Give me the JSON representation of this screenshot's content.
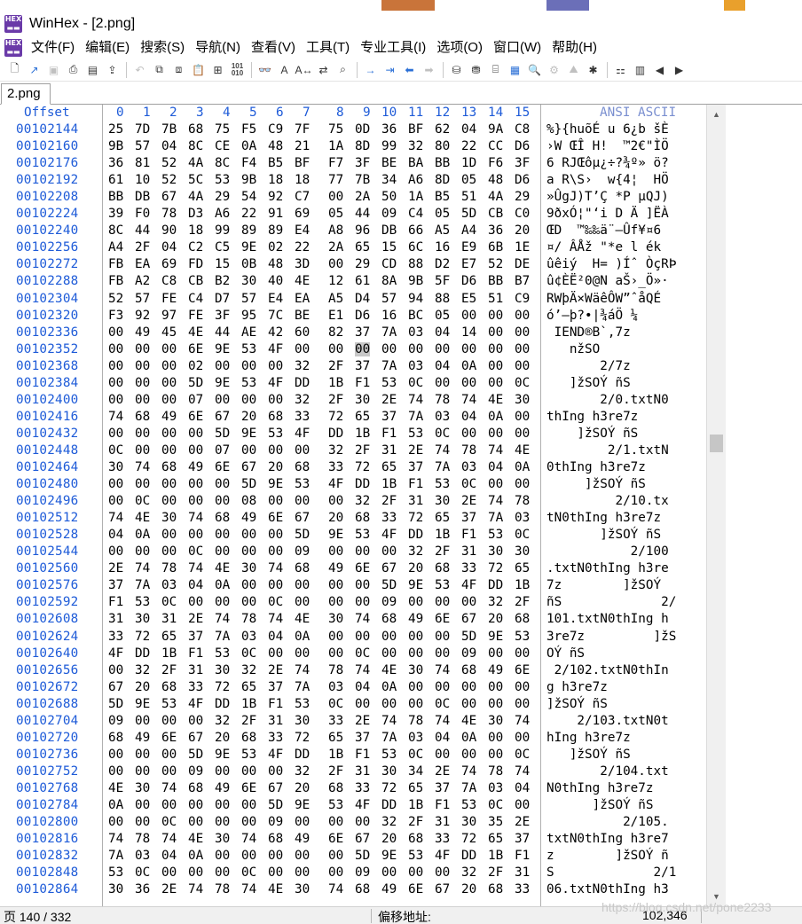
{
  "window": {
    "title": "WinHex - [2.png]",
    "app_icon_text": "HEX"
  },
  "menu": [
    "文件(F)",
    "编辑(E)",
    "搜索(S)",
    "导航(N)",
    "查看(V)",
    "工具(T)",
    "专业工具(I)",
    "选项(O)",
    "窗口(W)",
    "帮助(H)"
  ],
  "tabs": [
    {
      "label": "2.png",
      "active": true
    }
  ],
  "header": {
    "offset_label": "Offset",
    "columns": [
      "0",
      "1",
      "2",
      "3",
      "4",
      "5",
      "6",
      "7",
      "8",
      "9",
      "10",
      "11",
      "12",
      "13",
      "14",
      "15"
    ],
    "ansi_label": "ANSI ASCII"
  },
  "cursor": {
    "row": 13,
    "col": 9
  },
  "rows": [
    {
      "offset": "00102144",
      "bytes": [
        "25",
        "7D",
        "7B",
        "68",
        "75",
        "F5",
        "C9",
        "7F",
        "75",
        "0D",
        "36",
        "BF",
        "62",
        "04",
        "9A",
        "C8"
      ],
      "ascii": "%}{huõÉ u 6¿b šÈ"
    },
    {
      "offset": "00102160",
      "bytes": [
        "9B",
        "57",
        "04",
        "8C",
        "CE",
        "0A",
        "48",
        "21",
        "1A",
        "8D",
        "99",
        "32",
        "80",
        "22",
        "CC",
        "D6"
      ],
      "ascii": "›W ŒÎ H!  ™2€\"ÌÖ"
    },
    {
      "offset": "00102176",
      "bytes": [
        "36",
        "81",
        "52",
        "4A",
        "8C",
        "F4",
        "B5",
        "BF",
        "F7",
        "3F",
        "BE",
        "BA",
        "BB",
        "1D",
        "F6",
        "3F"
      ],
      "ascii": "6 RJŒôµ¿÷?¾º» ö?"
    },
    {
      "offset": "00102192",
      "bytes": [
        "61",
        "10",
        "52",
        "5C",
        "53",
        "9B",
        "18",
        "18",
        "77",
        "7B",
        "34",
        "A6",
        "8D",
        "05",
        "48",
        "D6"
      ],
      "ascii": "a R\\S›  w{4¦  HÖ"
    },
    {
      "offset": "00102208",
      "bytes": [
        "BB",
        "DB",
        "67",
        "4A",
        "29",
        "54",
        "92",
        "C7",
        "00",
        "2A",
        "50",
        "1A",
        "B5",
        "51",
        "4A",
        "29"
      ],
      "ascii": "»ÛgJ)T’Ç *P µQJ)"
    },
    {
      "offset": "00102224",
      "bytes": [
        "39",
        "F0",
        "78",
        "D3",
        "A6",
        "22",
        "91",
        "69",
        "05",
        "44",
        "09",
        "C4",
        "05",
        "5D",
        "CB",
        "C0"
      ],
      "ascii": "9ðxÓ¦\"‘i D Ä ]ËÀ"
    },
    {
      "offset": "00102240",
      "bytes": [
        "8C",
        "44",
        "90",
        "18",
        "99",
        "89",
        "89",
        "E4",
        "A8",
        "96",
        "DB",
        "66",
        "A5",
        "A4",
        "36",
        "20"
      ],
      "ascii": "ŒD  ™‰‰ä¨–Ûf¥¤6 "
    },
    {
      "offset": "00102256",
      "bytes": [
        "A4",
        "2F",
        "04",
        "C2",
        "C5",
        "9E",
        "02",
        "22",
        "2A",
        "65",
        "15",
        "6C",
        "16",
        "E9",
        "6B",
        "1E"
      ],
      "ascii": "¤/ ÂÅž \"*e l ék "
    },
    {
      "offset": "00102272",
      "bytes": [
        "FB",
        "EA",
        "69",
        "FD",
        "15",
        "0B",
        "48",
        "3D",
        "00",
        "29",
        "CD",
        "88",
        "D2",
        "E7",
        "52",
        "DE"
      ],
      "ascii": "ûêiý  H= )Íˆ ÒçRÞ"
    },
    {
      "offset": "00102288",
      "bytes": [
        "FB",
        "A2",
        "C8",
        "CB",
        "B2",
        "30",
        "40",
        "4E",
        "12",
        "61",
        "8A",
        "9B",
        "5F",
        "D6",
        "BB",
        "B7"
      ],
      "ascii": "û¢ÈË²0@N aŠ›_Ö»·"
    },
    {
      "offset": "00102304",
      "bytes": [
        "52",
        "57",
        "FE",
        "C4",
        "D7",
        "57",
        "E4",
        "EA",
        "A5",
        "D4",
        "57",
        "94",
        "88",
        "E5",
        "51",
        "C9"
      ],
      "ascii": "RWþÄ×WäêÔW”ˆåQÉ"
    },
    {
      "offset": "00102320",
      "bytes": [
        "F3",
        "92",
        "97",
        "FE",
        "3F",
        "95",
        "7C",
        "BE",
        "E1",
        "D6",
        "16",
        "BC",
        "05",
        "00",
        "00",
        "00"
      ],
      "ascii": "ó’—þ?•|¾áÖ ¼"
    },
    {
      "offset": "00102336",
      "bytes": [
        "00",
        "49",
        "45",
        "4E",
        "44",
        "AE",
        "42",
        "60",
        "82",
        "37",
        "7A",
        "03",
        "04",
        "14",
        "00",
        "00"
      ],
      "ascii": " IEND®B`‚7z"
    },
    {
      "offset": "00102352",
      "bytes": [
        "00",
        "00",
        "00",
        "6E",
        "9E",
        "53",
        "4F",
        "00",
        "00",
        "00",
        "00",
        "00",
        "00",
        "00",
        "00",
        "00"
      ],
      "ascii": "   nžSO"
    },
    {
      "offset": "00102368",
      "bytes": [
        "00",
        "00",
        "00",
        "02",
        "00",
        "00",
        "00",
        "32",
        "2F",
        "37",
        "7A",
        "03",
        "04",
        "0A",
        "00",
        "00"
      ],
      "ascii": "       2/7z"
    },
    {
      "offset": "00102384",
      "bytes": [
        "00",
        "00",
        "00",
        "5D",
        "9E",
        "53",
        "4F",
        "DD",
        "1B",
        "F1",
        "53",
        "0C",
        "00",
        "00",
        "00",
        "0C"
      ],
      "ascii": "   ]žSOÝ ñS"
    },
    {
      "offset": "00102400",
      "bytes": [
        "00",
        "00",
        "00",
        "07",
        "00",
        "00",
        "00",
        "32",
        "2F",
        "30",
        "2E",
        "74",
        "78",
        "74",
        "4E",
        "30"
      ],
      "ascii": "       2/0.txtN0"
    },
    {
      "offset": "00102416",
      "bytes": [
        "74",
        "68",
        "49",
        "6E",
        "67",
        "20",
        "68",
        "33",
        "72",
        "65",
        "37",
        "7A",
        "03",
        "04",
        "0A",
        "00"
      ],
      "ascii": "thIng h3re7z"
    },
    {
      "offset": "00102432",
      "bytes": [
        "00",
        "00",
        "00",
        "00",
        "5D",
        "9E",
        "53",
        "4F",
        "DD",
        "1B",
        "F1",
        "53",
        "0C",
        "00",
        "00",
        "00"
      ],
      "ascii": "    ]žSOÝ ñS"
    },
    {
      "offset": "00102448",
      "bytes": [
        "0C",
        "00",
        "00",
        "00",
        "07",
        "00",
        "00",
        "00",
        "32",
        "2F",
        "31",
        "2E",
        "74",
        "78",
        "74",
        "4E"
      ],
      "ascii": "        2/1.txtN"
    },
    {
      "offset": "00102464",
      "bytes": [
        "30",
        "74",
        "68",
        "49",
        "6E",
        "67",
        "20",
        "68",
        "33",
        "72",
        "65",
        "37",
        "7A",
        "03",
        "04",
        "0A"
      ],
      "ascii": "0thIng h3re7z"
    },
    {
      "offset": "00102480",
      "bytes": [
        "00",
        "00",
        "00",
        "00",
        "00",
        "5D",
        "9E",
        "53",
        "4F",
        "DD",
        "1B",
        "F1",
        "53",
        "0C",
        "00",
        "00"
      ],
      "ascii": "     ]žSOÝ ñS"
    },
    {
      "offset": "00102496",
      "bytes": [
        "00",
        "0C",
        "00",
        "00",
        "00",
        "08",
        "00",
        "00",
        "00",
        "32",
        "2F",
        "31",
        "30",
        "2E",
        "74",
        "78"
      ],
      "ascii": "         2/10.tx"
    },
    {
      "offset": "00102512",
      "bytes": [
        "74",
        "4E",
        "30",
        "74",
        "68",
        "49",
        "6E",
        "67",
        "20",
        "68",
        "33",
        "72",
        "65",
        "37",
        "7A",
        "03"
      ],
      "ascii": "tN0thIng h3re7z"
    },
    {
      "offset": "00102528",
      "bytes": [
        "04",
        "0A",
        "00",
        "00",
        "00",
        "00",
        "00",
        "5D",
        "9E",
        "53",
        "4F",
        "DD",
        "1B",
        "F1",
        "53",
        "0C"
      ],
      "ascii": "       ]žSOÝ ñS"
    },
    {
      "offset": "00102544",
      "bytes": [
        "00",
        "00",
        "00",
        "0C",
        "00",
        "00",
        "00",
        "09",
        "00",
        "00",
        "00",
        "32",
        "2F",
        "31",
        "30",
        "30"
      ],
      "ascii": "           2/100"
    },
    {
      "offset": "00102560",
      "bytes": [
        "2E",
        "74",
        "78",
        "74",
        "4E",
        "30",
        "74",
        "68",
        "49",
        "6E",
        "67",
        "20",
        "68",
        "33",
        "72",
        "65"
      ],
      "ascii": ".txtN0thIng h3re"
    },
    {
      "offset": "00102576",
      "bytes": [
        "37",
        "7A",
        "03",
        "04",
        "0A",
        "00",
        "00",
        "00",
        "00",
        "00",
        "5D",
        "9E",
        "53",
        "4F",
        "DD",
        "1B"
      ],
      "ascii": "7z        ]žSOÝ"
    },
    {
      "offset": "00102592",
      "bytes": [
        "F1",
        "53",
        "0C",
        "00",
        "00",
        "00",
        "0C",
        "00",
        "00",
        "00",
        "09",
        "00",
        "00",
        "00",
        "32",
        "2F"
      ],
      "ascii": "ñS             2/"
    },
    {
      "offset": "00102608",
      "bytes": [
        "31",
        "30",
        "31",
        "2E",
        "74",
        "78",
        "74",
        "4E",
        "30",
        "74",
        "68",
        "49",
        "6E",
        "67",
        "20",
        "68"
      ],
      "ascii": "101.txtN0thIng h"
    },
    {
      "offset": "00102624",
      "bytes": [
        "33",
        "72",
        "65",
        "37",
        "7A",
        "03",
        "04",
        "0A",
        "00",
        "00",
        "00",
        "00",
        "00",
        "5D",
        "9E",
        "53"
      ],
      "ascii": "3re7z         ]žS"
    },
    {
      "offset": "00102640",
      "bytes": [
        "4F",
        "DD",
        "1B",
        "F1",
        "53",
        "0C",
        "00",
        "00",
        "00",
        "0C",
        "00",
        "00",
        "00",
        "09",
        "00",
        "00"
      ],
      "ascii": "OÝ ñS"
    },
    {
      "offset": "00102656",
      "bytes": [
        "00",
        "32",
        "2F",
        "31",
        "30",
        "32",
        "2E",
        "74",
        "78",
        "74",
        "4E",
        "30",
        "74",
        "68",
        "49",
        "6E"
      ],
      "ascii": " 2/102.txtN0thIn"
    },
    {
      "offset": "00102672",
      "bytes": [
        "67",
        "20",
        "68",
        "33",
        "72",
        "65",
        "37",
        "7A",
        "03",
        "04",
        "0A",
        "00",
        "00",
        "00",
        "00",
        "00"
      ],
      "ascii": "g h3re7z"
    },
    {
      "offset": "00102688",
      "bytes": [
        "5D",
        "9E",
        "53",
        "4F",
        "DD",
        "1B",
        "F1",
        "53",
        "0C",
        "00",
        "00",
        "00",
        "0C",
        "00",
        "00",
        "00"
      ],
      "ascii": "]žSOÝ ñS"
    },
    {
      "offset": "00102704",
      "bytes": [
        "09",
        "00",
        "00",
        "00",
        "32",
        "2F",
        "31",
        "30",
        "33",
        "2E",
        "74",
        "78",
        "74",
        "4E",
        "30",
        "74"
      ],
      "ascii": "    2/103.txtN0t"
    },
    {
      "offset": "00102720",
      "bytes": [
        "68",
        "49",
        "6E",
        "67",
        "20",
        "68",
        "33",
        "72",
        "65",
        "37",
        "7A",
        "03",
        "04",
        "0A",
        "00",
        "00"
      ],
      "ascii": "hIng h3re7z"
    },
    {
      "offset": "00102736",
      "bytes": [
        "00",
        "00",
        "00",
        "5D",
        "9E",
        "53",
        "4F",
        "DD",
        "1B",
        "F1",
        "53",
        "0C",
        "00",
        "00",
        "00",
        "0C"
      ],
      "ascii": "   ]žSOÝ ñS"
    },
    {
      "offset": "00102752",
      "bytes": [
        "00",
        "00",
        "00",
        "09",
        "00",
        "00",
        "00",
        "32",
        "2F",
        "31",
        "30",
        "34",
        "2E",
        "74",
        "78",
        "74"
      ],
      "ascii": "       2/104.txt"
    },
    {
      "offset": "00102768",
      "bytes": [
        "4E",
        "30",
        "74",
        "68",
        "49",
        "6E",
        "67",
        "20",
        "68",
        "33",
        "72",
        "65",
        "37",
        "7A",
        "03",
        "04"
      ],
      "ascii": "N0thIng h3re7z"
    },
    {
      "offset": "00102784",
      "bytes": [
        "0A",
        "00",
        "00",
        "00",
        "00",
        "00",
        "5D",
        "9E",
        "53",
        "4F",
        "DD",
        "1B",
        "F1",
        "53",
        "0C",
        "00"
      ],
      "ascii": "      ]žSOÝ ñS"
    },
    {
      "offset": "00102800",
      "bytes": [
        "00",
        "00",
        "0C",
        "00",
        "00",
        "00",
        "09",
        "00",
        "00",
        "00",
        "32",
        "2F",
        "31",
        "30",
        "35",
        "2E"
      ],
      "ascii": "          2/105."
    },
    {
      "offset": "00102816",
      "bytes": [
        "74",
        "78",
        "74",
        "4E",
        "30",
        "74",
        "68",
        "49",
        "6E",
        "67",
        "20",
        "68",
        "33",
        "72",
        "65",
        "37"
      ],
      "ascii": "txtN0thIng h3re7"
    },
    {
      "offset": "00102832",
      "bytes": [
        "7A",
        "03",
        "04",
        "0A",
        "00",
        "00",
        "00",
        "00",
        "00",
        "5D",
        "9E",
        "53",
        "4F",
        "DD",
        "1B",
        "F1"
      ],
      "ascii": "z        ]žSOÝ ñ"
    },
    {
      "offset": "00102848",
      "bytes": [
        "53",
        "0C",
        "00",
        "00",
        "00",
        "0C",
        "00",
        "00",
        "00",
        "09",
        "00",
        "00",
        "00",
        "32",
        "2F",
        "31"
      ],
      "ascii": "S             2/1"
    },
    {
      "offset": "00102864",
      "bytes": [
        "30",
        "36",
        "2E",
        "74",
        "78",
        "74",
        "4E",
        "30",
        "74",
        "68",
        "49",
        "6E",
        "67",
        "20",
        "68",
        "33"
      ],
      "ascii": "06.txtN0thIng h3"
    }
  ],
  "status": {
    "page_text": "页 140 / 332",
    "offset_label": "偏移地址:",
    "offset_value": "102,346",
    "watermark": "https://blog.csdn.net/pone2233"
  }
}
